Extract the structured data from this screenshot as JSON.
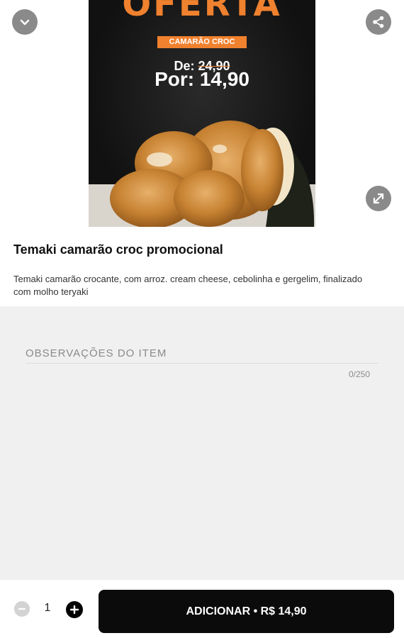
{
  "promo": {
    "headline": "OFERTA",
    "tag": "CAMARÃO CROC",
    "from_label": "De:",
    "from_price": "24,90",
    "to_label": "Por:",
    "to_price": "14,90",
    "accent_color": "#f0812e"
  },
  "buttons": {
    "collapse_icon": "chevron-down-icon",
    "share_icon": "share-icon",
    "expand_icon": "expand-icon"
  },
  "product": {
    "name": "Temaki camarão croc promocional",
    "description": "Temaki camarão crocante, com arroz. cream cheese, cebolinha e gergelim, finalizado com molho teryaki"
  },
  "notes": {
    "placeholder": "OBSERVAÇÕES DO ITEM",
    "value": "",
    "counter": "0/250"
  },
  "cart": {
    "quantity": "1",
    "minus_icon": "minus-icon",
    "plus_icon": "plus-icon",
    "add_label": "ADICIONAR • R$ 14,90"
  }
}
